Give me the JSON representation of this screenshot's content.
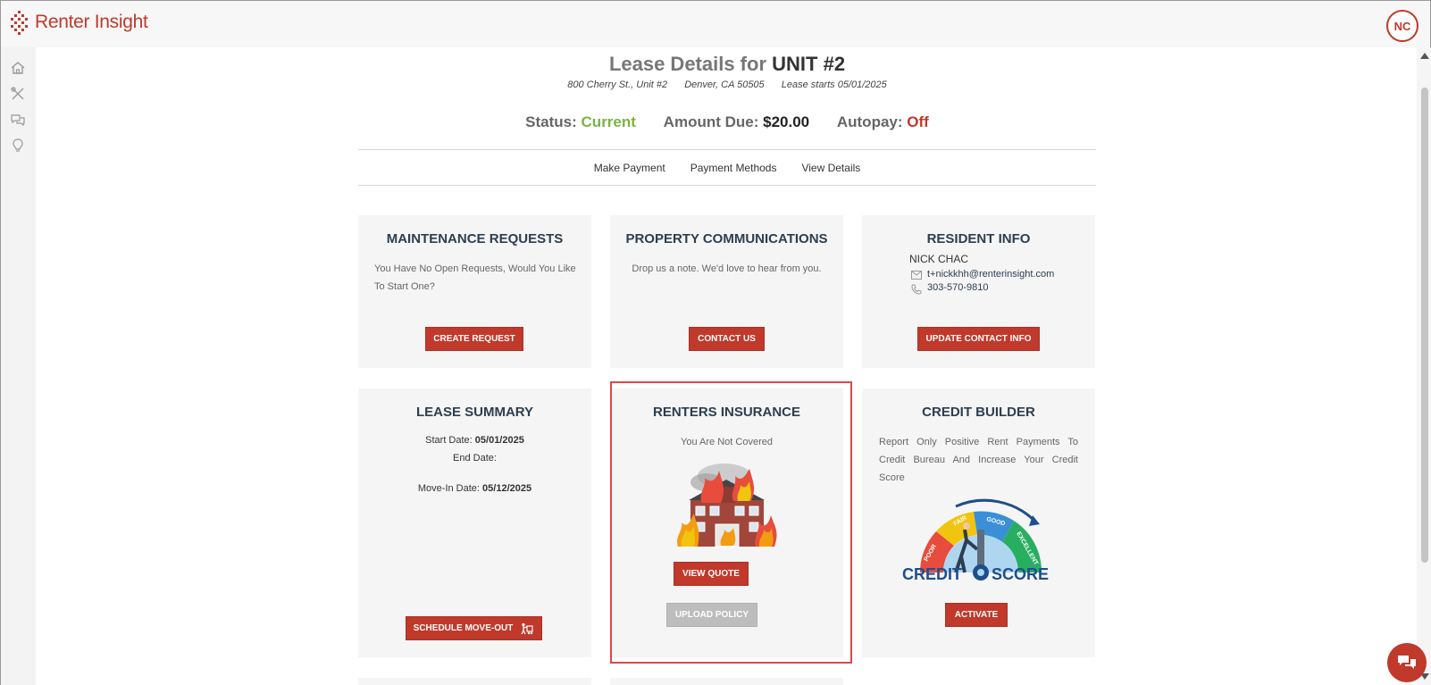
{
  "app": {
    "name": "Renter Insight",
    "user_initials": "NC"
  },
  "header": {
    "title_prefix": "Lease Details for",
    "title_unit": "UNIT #2",
    "address": "800 Cherry St., Unit #2",
    "city": "Denver, CA 50505",
    "lease_start": "Lease starts 05/01/2025"
  },
  "status": {
    "status_label": "Status:",
    "status_value": "Current",
    "amount_label": "Amount Due:",
    "amount_value": "$20.00",
    "autopay_label": "Autopay:",
    "autopay_value": "Off"
  },
  "tabs": [
    "Make Payment",
    "Payment Methods",
    "View Details"
  ],
  "cards": {
    "maintenance": {
      "title": "MAINTENANCE REQUESTS",
      "text": "You Have No Open Requests, Would You Like To Start One?",
      "button": "CREATE REQUEST"
    },
    "communications": {
      "title": "PROPERTY COMMUNICATIONS",
      "text": "Drop us a note. We'd love to hear from you.",
      "button": "CONTACT US"
    },
    "resident": {
      "title": "RESIDENT INFO",
      "name": "NICK CHAC",
      "email": "t+nickkhh@renterinsight.com",
      "phone": "303-570-9810",
      "button": "UPDATE CONTACT INFO"
    },
    "lease": {
      "title": "LEASE SUMMARY",
      "start_label": "Start Date:",
      "start_value": "05/01/2025",
      "end_label": "End Date:",
      "movein_label": "Move-In Date:",
      "movein_value": "05/12/2025",
      "button": "SCHEDULE MOVE-OUT"
    },
    "insurance": {
      "title": "RENTERS INSURANCE",
      "text": "You Are Not Covered",
      "button_quote": "VIEW QUOTE",
      "button_upload": "UPLOAD POLICY"
    },
    "credit": {
      "title": "CREDIT BUILDER",
      "text": "Report Only Positive Rent Payments To Credit Bureau And Increase Your Credit Score",
      "gauge_labels": [
        "POOR",
        "FAIR",
        "GOOD",
        "EXCELLENT"
      ],
      "gauge_word_left": "CREDIT",
      "gauge_word_right": "SCORE",
      "button": "ACTIVATE"
    }
  },
  "colors": {
    "accent": "#c0392b",
    "status_green": "#7cb342",
    "title_navy": "#2c3e50"
  }
}
